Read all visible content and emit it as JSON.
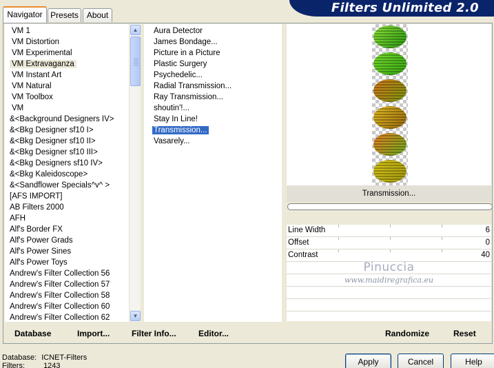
{
  "tabs": [
    "Navigator",
    "Presets",
    "About"
  ],
  "banner_title": "Filters Unlimited 2.0",
  "categories": [
    "VM 1",
    "VM Distortion",
    "VM Experimental",
    "VM Extravaganza",
    "VM Instant Art",
    "VM Natural",
    "VM Toolbox",
    "VM",
    "&<Background Designers IV>",
    "&<Bkg Designer sf10 I>",
    "&<Bkg Designer sf10 II>",
    "&<Bkg Designer sf10 III>",
    "&<Bkg Designers sf10 IV>",
    "&<Bkg Kaleidoscope>",
    "&<Sandflower Specials^v^ >",
    "[AFS IMPORT]",
    "AB Filters 2000",
    "AFH",
    "Alf's Border FX",
    "Alf's Power Grads",
    "Alf's Power Sines",
    "Alf's Power Toys",
    "Andrew's Filter Collection 56",
    "Andrew's Filter Collection 57",
    "Andrew's Filter Collection 58",
    "Andrew's Filter Collection 60",
    "Andrew's Filter Collection 62"
  ],
  "selected_category": "VM Extravaganza",
  "filters": [
    "Aura Detector",
    "James Bondage...",
    "Picture in a Picture",
    "Plastic Surgery",
    "Psychedelic...",
    "Radial Transmission...",
    "Ray Transmission...",
    "shoutin'!...",
    "Stay In Line!",
    "Transmission...",
    "Vasarely..."
  ],
  "selected_filter": "Transmission...",
  "preview_label": "Transmission...",
  "params": [
    {
      "name": "Line Width",
      "value": "6"
    },
    {
      "name": "Offset",
      "value": "0"
    },
    {
      "name": "Contrast",
      "value": "40"
    }
  ],
  "watermark": {
    "name": "Pinuccia",
    "url": "www.maidiregrafica.eu"
  },
  "links": {
    "database": "Database",
    "import": "Import...",
    "filter_info": "Filter Info...",
    "editor": "Editor...",
    "randomize": "Randomize",
    "reset": "Reset"
  },
  "status": {
    "database_label": "Database:",
    "database_value": "ICNET-Filters",
    "filters_label": "Filters:",
    "filters_value": "1243"
  },
  "buttons": {
    "apply": "Apply",
    "cancel": "Cancel",
    "help": "Help"
  },
  "colors": {
    "accent": "#316ac5",
    "banner": "#0a246a",
    "tab_highlight": "#e68b2c"
  },
  "preview_ovals": [
    {
      "top": "#8ee63a",
      "bottom": "#2a9a10"
    },
    {
      "top": "#7ae02e",
      "bottom": "#36a812"
    },
    {
      "top": "#d97a1a",
      "bottom": "#7c9a10"
    },
    {
      "top": "#e8c020",
      "bottom": "#9a6a10"
    },
    {
      "top": "#f08020",
      "bottom": "#6ab020"
    },
    {
      "top": "#d8c818",
      "bottom": "#a89a10"
    }
  ]
}
